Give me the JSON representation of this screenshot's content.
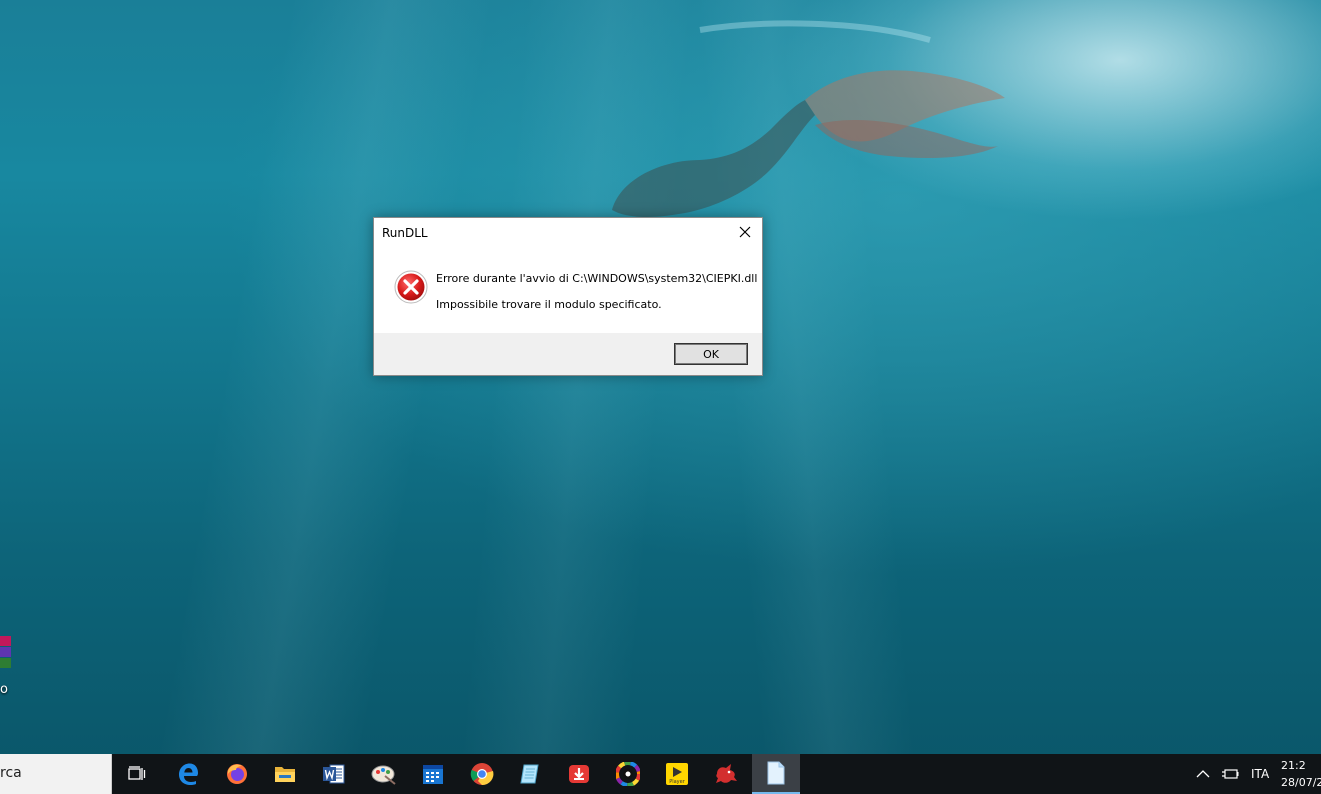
{
  "dialog": {
    "title": "RunDLL",
    "message_line1": "Errore durante l'avvio di C:\\WINDOWS\\system32\\CIEPKI.dll",
    "message_line2": "Impossibile trovare il modulo specificato.",
    "ok_label": "OK"
  },
  "desktop": {
    "icon_label_partial": "o"
  },
  "taskbar": {
    "search_text": "rca",
    "apps": [
      {
        "name": "task-view",
        "icon": "task-view-icon"
      },
      {
        "name": "edge",
        "icon": "edge-icon"
      },
      {
        "name": "firefox",
        "icon": "firefox-icon"
      },
      {
        "name": "file-explorer",
        "icon": "folder-icon"
      },
      {
        "name": "word",
        "icon": "word-icon"
      },
      {
        "name": "paint",
        "icon": "paint-icon"
      },
      {
        "name": "calendar",
        "icon": "calendar-icon"
      },
      {
        "name": "chrome",
        "icon": "chrome-icon"
      },
      {
        "name": "notepad",
        "icon": "notepad-icon"
      },
      {
        "name": "downloader",
        "icon": "download-icon"
      },
      {
        "name": "color-app",
        "icon": "color-wheel-icon"
      },
      {
        "name": "player",
        "icon": "player-icon"
      },
      {
        "name": "red-app",
        "icon": "red-creature-icon"
      },
      {
        "name": "document",
        "icon": "document-icon",
        "active": true
      }
    ],
    "player_text": "Player",
    "language": "ITA",
    "time_partial": "21:2",
    "date_partial": "28/07/2"
  },
  "colors": {
    "error_red": "#e81123",
    "taskbar_bg": "#101417",
    "active_indicator": "#76b9ed"
  }
}
